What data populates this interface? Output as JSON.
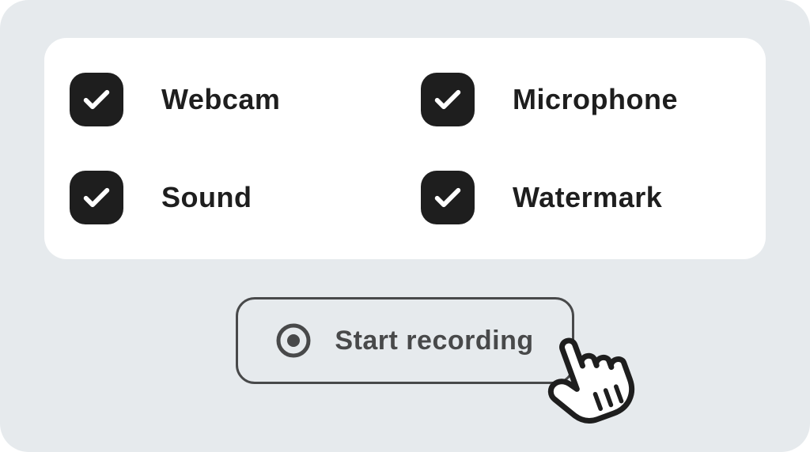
{
  "options": {
    "webcam": {
      "label": "Webcam",
      "checked": true
    },
    "microphone": {
      "label": "Microphone",
      "checked": true
    },
    "sound": {
      "label": "Sound",
      "checked": true
    },
    "watermark": {
      "label": "Watermark",
      "checked": true
    }
  },
  "record_button": {
    "label": "Start recording"
  }
}
